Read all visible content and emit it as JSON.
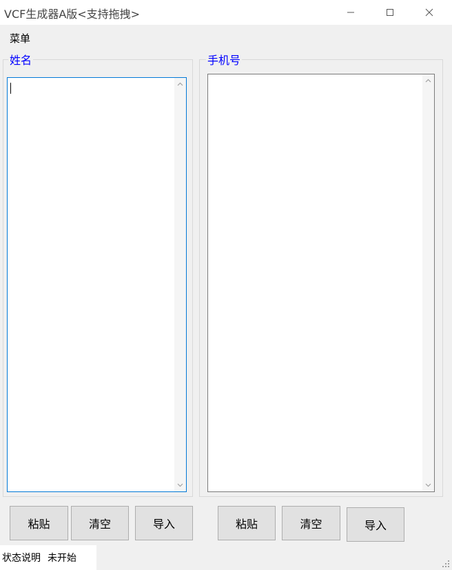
{
  "window": {
    "title": "VCF生成器A版<支持拖拽>",
    "minimize_icon": "minimize-icon",
    "maximize_icon": "maximize-icon",
    "close_icon": "close-icon"
  },
  "menubar": {
    "menu_label": "菜单"
  },
  "name_panel": {
    "legend": "姓名",
    "text": "",
    "buttons": {
      "paste": "粘贴",
      "clear": "清空",
      "import": "导入"
    }
  },
  "phone_panel": {
    "legend": "手机号",
    "text": "",
    "buttons": {
      "paste": "粘贴",
      "clear": "清空",
      "import": "导入"
    }
  },
  "statusbar": {
    "label": "状态说明",
    "value": "未开始"
  },
  "colors": {
    "legend_text": "#0000ff",
    "focus_border": "#0078d7",
    "button_face": "#e1e1e1"
  }
}
